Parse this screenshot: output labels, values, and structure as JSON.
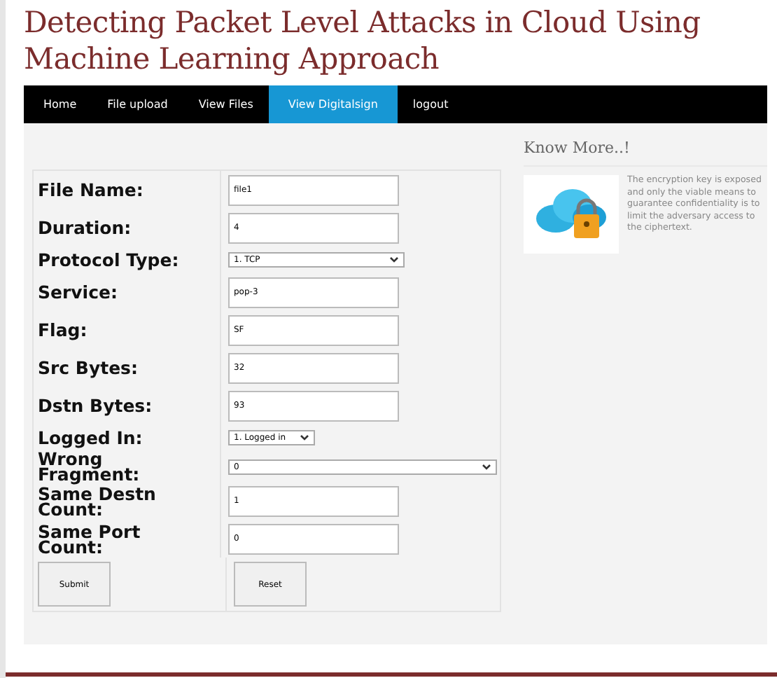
{
  "title": "Detecting Packet Level Attacks in Cloud Using Machine Learning Approach",
  "nav": [
    {
      "label": "Home",
      "selected": false
    },
    {
      "label": "File upload",
      "selected": false
    },
    {
      "label": "View Files",
      "selected": false
    },
    {
      "label": "View Digitalsign",
      "selected": true
    },
    {
      "label": "logout",
      "selected": false
    }
  ],
  "form": {
    "fields": [
      {
        "kind": "text",
        "label": "File Name:",
        "value": "file1"
      },
      {
        "kind": "text",
        "label": "Duration:",
        "value": "4"
      },
      {
        "kind": "select",
        "label": "Protocol Type:",
        "value": "1. TCP"
      },
      {
        "kind": "text",
        "label": "Service:",
        "value": "pop-3"
      },
      {
        "kind": "text",
        "label": "Flag:",
        "value": "SF"
      },
      {
        "kind": "text",
        "label": "Src Bytes:",
        "value": "32"
      },
      {
        "kind": "text",
        "label": "Dstn Bytes:",
        "value": "93"
      },
      {
        "kind": "shortselect",
        "label": "Logged In:",
        "value": "1. Logged in"
      },
      {
        "kind": "longselect",
        "label": "Wrong Fragment:",
        "value": "0"
      },
      {
        "kind": "text",
        "label": "Same Destn Count:",
        "value": "1"
      },
      {
        "kind": "text",
        "label": "Same Port Count:",
        "value": "0"
      }
    ],
    "buttons": [
      "Submit",
      "Reset"
    ]
  },
  "sidebar": {
    "heading": "Know More..!",
    "text": "The encryption key is exposed and only the viable means to guarantee confidentiality is to limit the adversary access to the ciphertext."
  }
}
